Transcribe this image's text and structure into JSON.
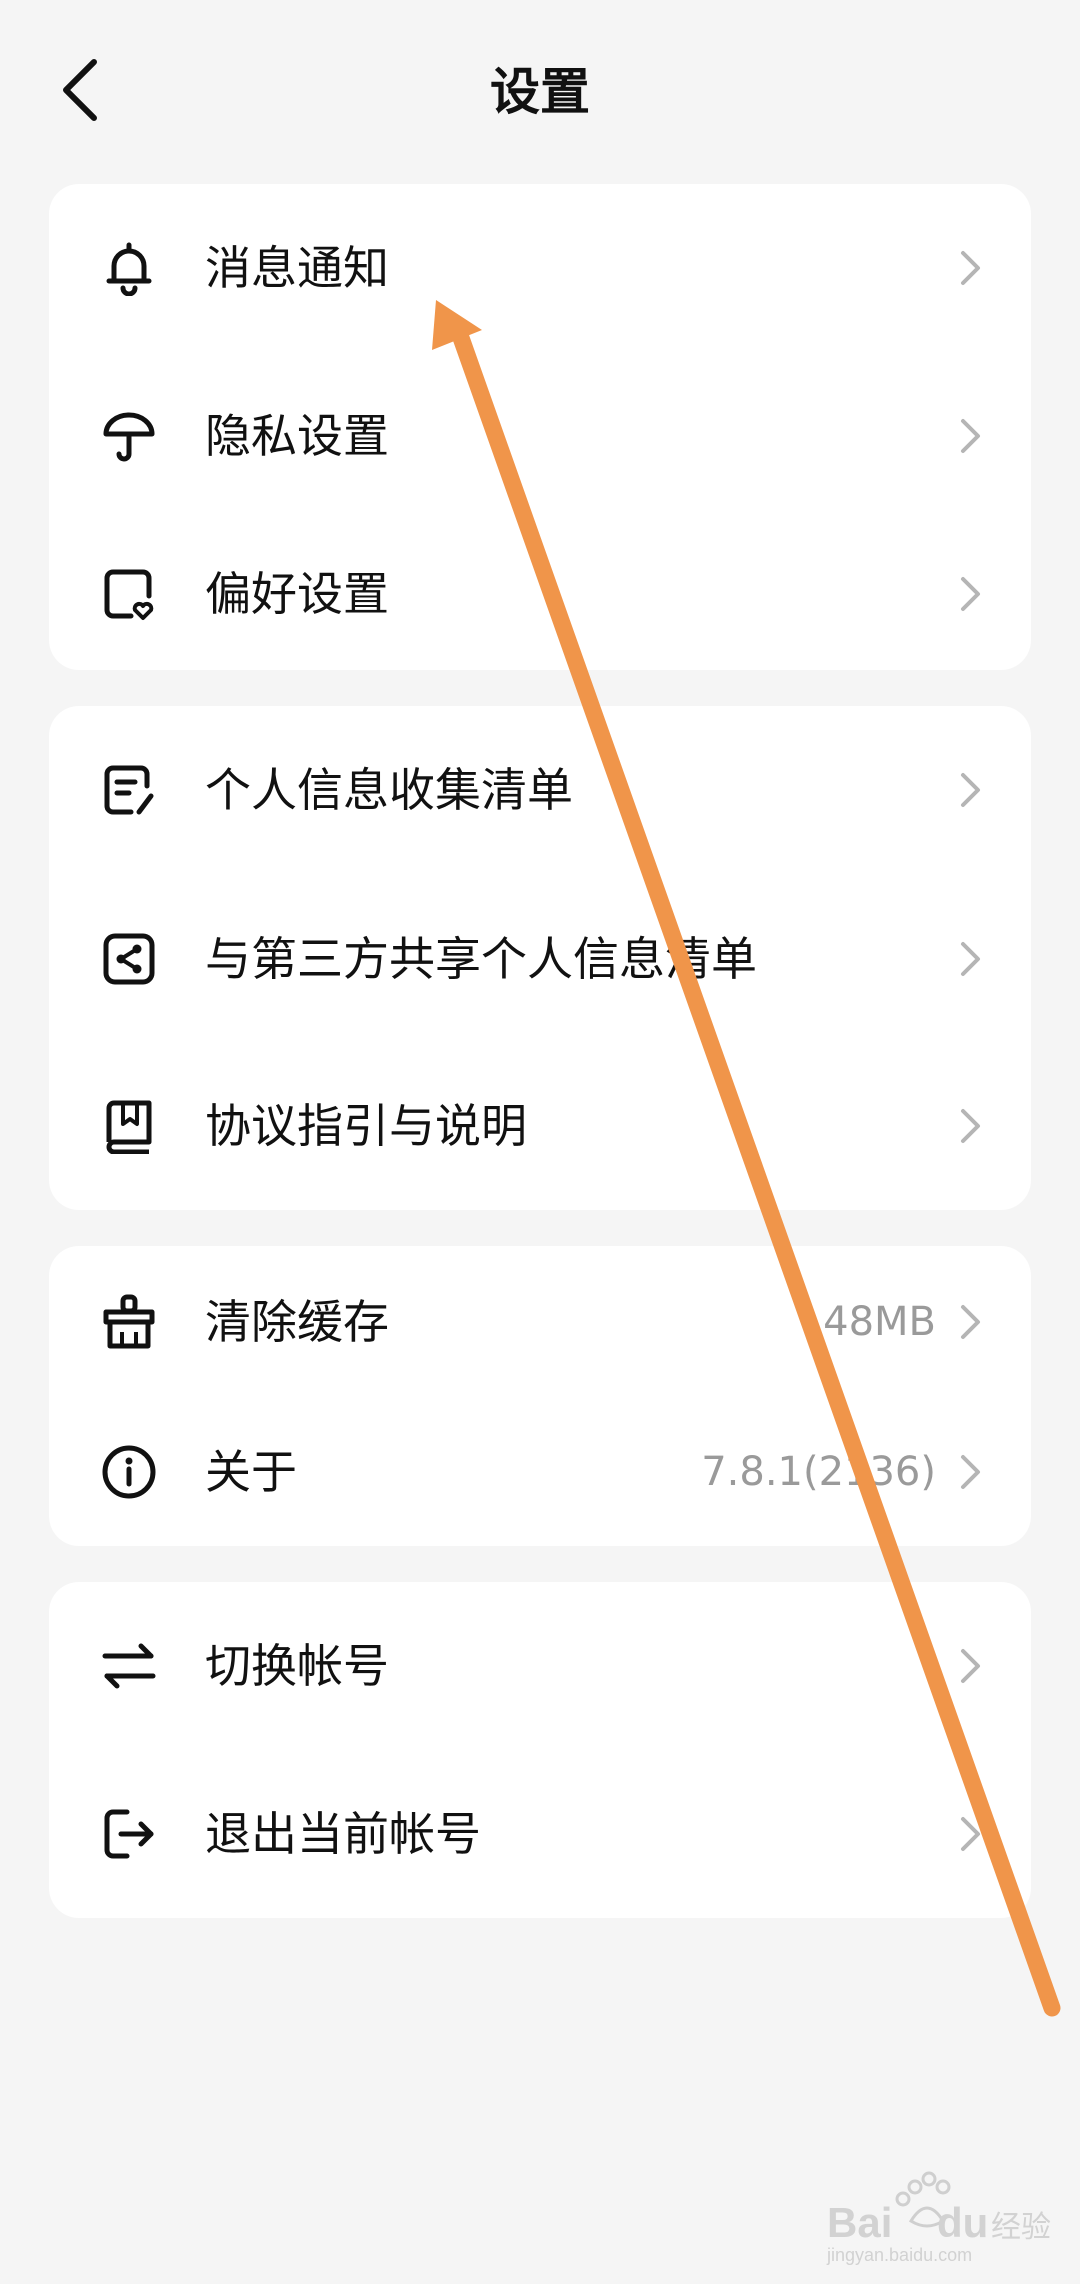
{
  "header": {
    "title": "设置",
    "back_icon": "chevron-left-icon"
  },
  "groups": [
    {
      "items": [
        {
          "label": "消息通知",
          "icon": "bell-icon"
        },
        {
          "label": "隐私设置",
          "icon": "umbrella-icon"
        },
        {
          "label": "偏好设置",
          "icon": "heart-document-icon"
        }
      ]
    },
    {
      "items": [
        {
          "label": "个人信息收集清单",
          "icon": "edit-document-icon"
        },
        {
          "label": "与第三方共享个人信息清单",
          "icon": "share-icon"
        },
        {
          "label": "协议指引与说明",
          "icon": "book-icon"
        }
      ]
    },
    {
      "items": [
        {
          "label": "清除缓存",
          "value": "48MB",
          "icon": "broom-icon"
        },
        {
          "label": "关于",
          "value": "7.8.1(2136)",
          "icon": "info-icon"
        }
      ]
    },
    {
      "items": [
        {
          "label": "切换帐号",
          "icon": "switch-arrows-icon"
        },
        {
          "label": "退出当前帐号",
          "icon": "logout-icon"
        }
      ]
    }
  ],
  "colors": {
    "background": "#f5f5f5",
    "card": "#ffffff",
    "chevron": "#b5b5b5",
    "value_text": "#9a9a9a",
    "annotation_arrow": "#f0954a"
  },
  "watermark": {
    "logo_text": "Baidu 经验",
    "url": "jingyan.baidu.com"
  }
}
